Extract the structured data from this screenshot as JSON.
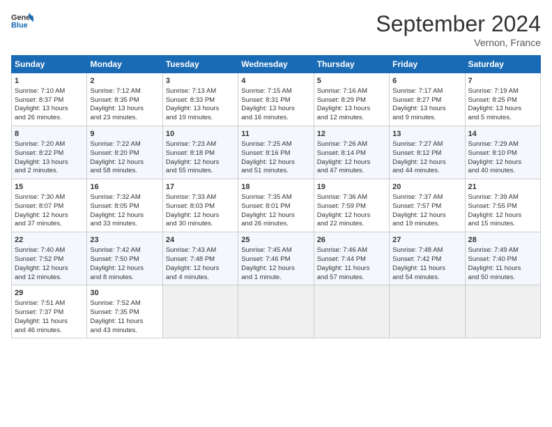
{
  "header": {
    "logo_line1": "General",
    "logo_line2": "Blue",
    "month_title": "September 2024",
    "location": "Vernon, France"
  },
  "days_of_week": [
    "Sunday",
    "Monday",
    "Tuesday",
    "Wednesday",
    "Thursday",
    "Friday",
    "Saturday"
  ],
  "weeks": [
    [
      {
        "day": "1",
        "lines": [
          "Sunrise: 7:10 AM",
          "Sunset: 8:37 PM",
          "Daylight: 13 hours",
          "and 26 minutes."
        ]
      },
      {
        "day": "2",
        "lines": [
          "Sunrise: 7:12 AM",
          "Sunset: 8:35 PM",
          "Daylight: 13 hours",
          "and 23 minutes."
        ]
      },
      {
        "day": "3",
        "lines": [
          "Sunrise: 7:13 AM",
          "Sunset: 8:33 PM",
          "Daylight: 13 hours",
          "and 19 minutes."
        ]
      },
      {
        "day": "4",
        "lines": [
          "Sunrise: 7:15 AM",
          "Sunset: 8:31 PM",
          "Daylight: 13 hours",
          "and 16 minutes."
        ]
      },
      {
        "day": "5",
        "lines": [
          "Sunrise: 7:16 AM",
          "Sunset: 8:29 PM",
          "Daylight: 13 hours",
          "and 12 minutes."
        ]
      },
      {
        "day": "6",
        "lines": [
          "Sunrise: 7:17 AM",
          "Sunset: 8:27 PM",
          "Daylight: 13 hours",
          "and 9 minutes."
        ]
      },
      {
        "day": "7",
        "lines": [
          "Sunrise: 7:19 AM",
          "Sunset: 8:25 PM",
          "Daylight: 13 hours",
          "and 5 minutes."
        ]
      }
    ],
    [
      {
        "day": "8",
        "lines": [
          "Sunrise: 7:20 AM",
          "Sunset: 8:22 PM",
          "Daylight: 13 hours",
          "and 2 minutes."
        ]
      },
      {
        "day": "9",
        "lines": [
          "Sunrise: 7:22 AM",
          "Sunset: 8:20 PM",
          "Daylight: 12 hours",
          "and 58 minutes."
        ]
      },
      {
        "day": "10",
        "lines": [
          "Sunrise: 7:23 AM",
          "Sunset: 8:18 PM",
          "Daylight: 12 hours",
          "and 55 minutes."
        ]
      },
      {
        "day": "11",
        "lines": [
          "Sunrise: 7:25 AM",
          "Sunset: 8:16 PM",
          "Daylight: 12 hours",
          "and 51 minutes."
        ]
      },
      {
        "day": "12",
        "lines": [
          "Sunrise: 7:26 AM",
          "Sunset: 8:14 PM",
          "Daylight: 12 hours",
          "and 47 minutes."
        ]
      },
      {
        "day": "13",
        "lines": [
          "Sunrise: 7:27 AM",
          "Sunset: 8:12 PM",
          "Daylight: 12 hours",
          "and 44 minutes."
        ]
      },
      {
        "day": "14",
        "lines": [
          "Sunrise: 7:29 AM",
          "Sunset: 8:10 PM",
          "Daylight: 12 hours",
          "and 40 minutes."
        ]
      }
    ],
    [
      {
        "day": "15",
        "lines": [
          "Sunrise: 7:30 AM",
          "Sunset: 8:07 PM",
          "Daylight: 12 hours",
          "and 37 minutes."
        ]
      },
      {
        "day": "16",
        "lines": [
          "Sunrise: 7:32 AM",
          "Sunset: 8:05 PM",
          "Daylight: 12 hours",
          "and 33 minutes."
        ]
      },
      {
        "day": "17",
        "lines": [
          "Sunrise: 7:33 AM",
          "Sunset: 8:03 PM",
          "Daylight: 12 hours",
          "and 30 minutes."
        ]
      },
      {
        "day": "18",
        "lines": [
          "Sunrise: 7:35 AM",
          "Sunset: 8:01 PM",
          "Daylight: 12 hours",
          "and 26 minutes."
        ]
      },
      {
        "day": "19",
        "lines": [
          "Sunrise: 7:36 AM",
          "Sunset: 7:59 PM",
          "Daylight: 12 hours",
          "and 22 minutes."
        ]
      },
      {
        "day": "20",
        "lines": [
          "Sunrise: 7:37 AM",
          "Sunset: 7:57 PM",
          "Daylight: 12 hours",
          "and 19 minutes."
        ]
      },
      {
        "day": "21",
        "lines": [
          "Sunrise: 7:39 AM",
          "Sunset: 7:55 PM",
          "Daylight: 12 hours",
          "and 15 minutes."
        ]
      }
    ],
    [
      {
        "day": "22",
        "lines": [
          "Sunrise: 7:40 AM",
          "Sunset: 7:52 PM",
          "Daylight: 12 hours",
          "and 12 minutes."
        ]
      },
      {
        "day": "23",
        "lines": [
          "Sunrise: 7:42 AM",
          "Sunset: 7:50 PM",
          "Daylight: 12 hours",
          "and 8 minutes."
        ]
      },
      {
        "day": "24",
        "lines": [
          "Sunrise: 7:43 AM",
          "Sunset: 7:48 PM",
          "Daylight: 12 hours",
          "and 4 minutes."
        ]
      },
      {
        "day": "25",
        "lines": [
          "Sunrise: 7:45 AM",
          "Sunset: 7:46 PM",
          "Daylight: 12 hours",
          "and 1 minute."
        ]
      },
      {
        "day": "26",
        "lines": [
          "Sunrise: 7:46 AM",
          "Sunset: 7:44 PM",
          "Daylight: 11 hours",
          "and 57 minutes."
        ]
      },
      {
        "day": "27",
        "lines": [
          "Sunrise: 7:48 AM",
          "Sunset: 7:42 PM",
          "Daylight: 11 hours",
          "and 54 minutes."
        ]
      },
      {
        "day": "28",
        "lines": [
          "Sunrise: 7:49 AM",
          "Sunset: 7:40 PM",
          "Daylight: 11 hours",
          "and 50 minutes."
        ]
      }
    ],
    [
      {
        "day": "29",
        "lines": [
          "Sunrise: 7:51 AM",
          "Sunset: 7:37 PM",
          "Daylight: 11 hours",
          "and 46 minutes."
        ]
      },
      {
        "day": "30",
        "lines": [
          "Sunrise: 7:52 AM",
          "Sunset: 7:35 PM",
          "Daylight: 11 hours",
          "and 43 minutes."
        ]
      },
      {
        "day": "",
        "lines": []
      },
      {
        "day": "",
        "lines": []
      },
      {
        "day": "",
        "lines": []
      },
      {
        "day": "",
        "lines": []
      },
      {
        "day": "",
        "lines": []
      }
    ]
  ]
}
